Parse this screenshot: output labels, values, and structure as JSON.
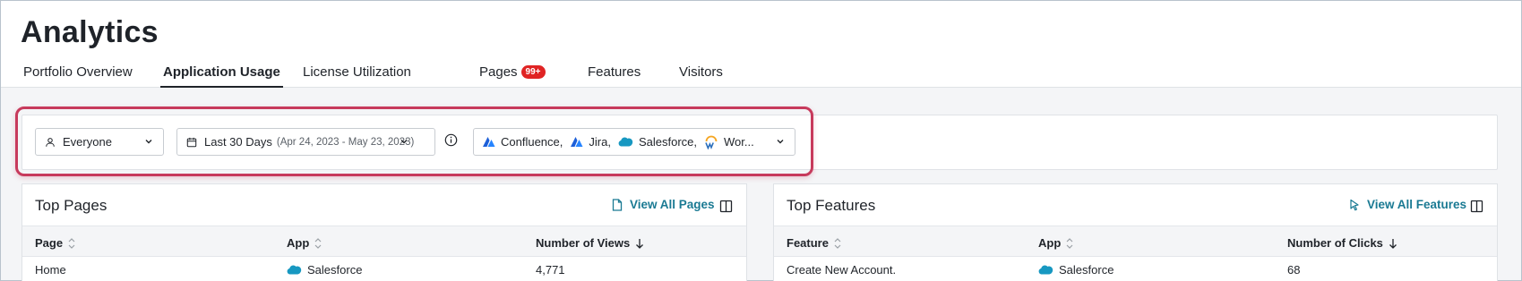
{
  "header": {
    "title": "Analytics",
    "tabs": [
      {
        "label": "Portfolio Overview"
      },
      {
        "label": "Application Usage",
        "active": true
      },
      {
        "label": "License Utilization"
      },
      {
        "label": "Pages",
        "badge": "99+"
      },
      {
        "label": "Features"
      },
      {
        "label": "Visitors"
      }
    ]
  },
  "filters": {
    "audience": "Everyone",
    "date_range": "Last 30 Days",
    "date_range_detail": "(Apr 24, 2023 - May 23, 2023)",
    "apps": [
      "Confluence,",
      "Jira,",
      "Salesforce,",
      "Wor..."
    ]
  },
  "top_pages": {
    "title": "Top Pages",
    "link": "View All Pages",
    "columns": [
      "Page",
      "App",
      "Number of Views"
    ],
    "rows": [
      {
        "page": "Home",
        "app": "Salesforce",
        "views": "4,771"
      }
    ]
  },
  "top_features": {
    "title": "Top Features",
    "link": "View All Features",
    "columns": [
      "Feature",
      "App",
      "Number of Clicks"
    ],
    "rows": [
      {
        "feature": "Create New Account.",
        "app": "Salesforce",
        "clicks": "68"
      }
    ]
  },
  "colors": {
    "accent_link": "#1a7a93",
    "badge": "#e02424",
    "highlight": "#c73a5c",
    "salesforce": "#1798c1",
    "atlassian": "#2684ff"
  }
}
